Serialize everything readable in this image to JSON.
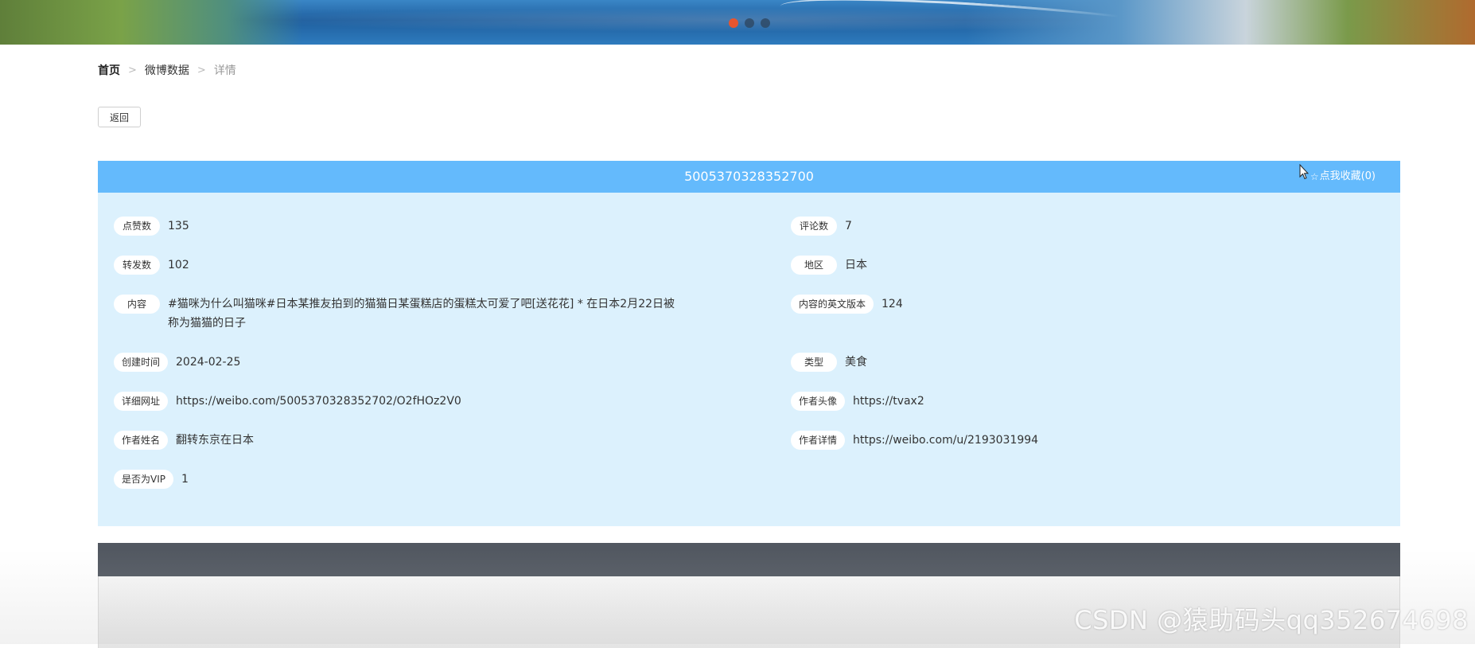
{
  "banner": {
    "slides": [
      {
        "active": true
      },
      {
        "active": false
      },
      {
        "active": false
      }
    ]
  },
  "breadcrumb": {
    "home": "首页",
    "section": "微博数据",
    "current": "详情",
    "separator": ">"
  },
  "back_button": "返回",
  "detail": {
    "title": "5005370328352700",
    "favorite": "点我收藏(0)",
    "fields": {
      "likes": {
        "label": "点赞数",
        "value": "135"
      },
      "comments": {
        "label": "评论数",
        "value": "7"
      },
      "reposts": {
        "label": "转发数",
        "value": "102"
      },
      "region": {
        "label": "地区",
        "value": "日本"
      },
      "content": {
        "label": "内容",
        "value": "#猫咪为什么叫猫咪#日本某推友拍到的猫猫日某蛋糕店的蛋糕太可爱了吧[送花花] * 在日本2月22日被称为猫猫的日子"
      },
      "content_en": {
        "label": "内容的英文版本",
        "value": "124"
      },
      "created": {
        "label": "创建时间",
        "value": "2024-02-25"
      },
      "type": {
        "label": "类型",
        "value": "美食"
      },
      "url": {
        "label": "详细网址",
        "value": "https://weibo.com/5005370328352702/O2fHOz2V0"
      },
      "avatar": {
        "label": "作者头像",
        "value": "https://tvax2"
      },
      "author_name": {
        "label": "作者姓名",
        "value": "翻转东京在日本"
      },
      "author_detail": {
        "label": "作者详情",
        "value": "https://weibo.com/u/2193031994"
      },
      "vip": {
        "label": "是否为VIP",
        "value": "1"
      }
    }
  },
  "watermark": "CSDN @猿助码头qq352674698",
  "colors": {
    "panel_header": "#64bafc",
    "panel_body": "#dcf1fd",
    "lower_header": "#525861",
    "active_dot": "#e8552f"
  }
}
